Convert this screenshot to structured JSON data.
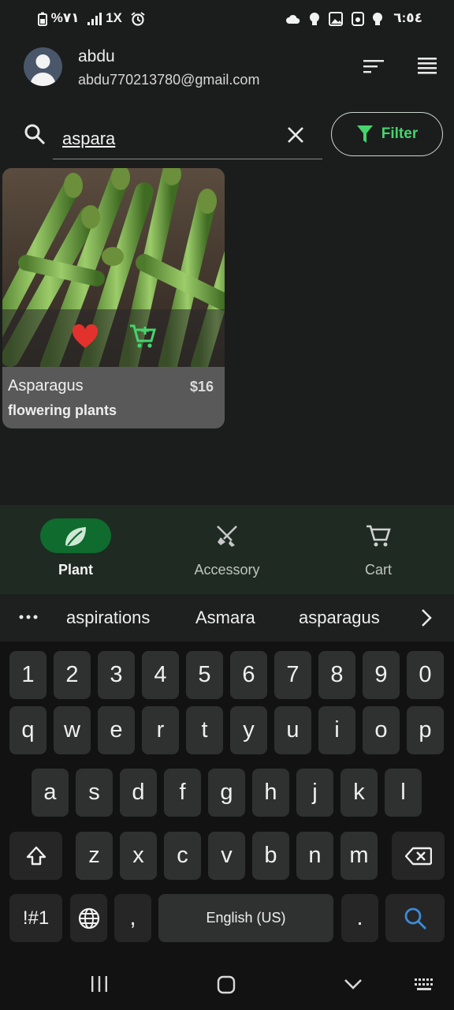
{
  "status_bar": {
    "left_text": "%٧١",
    "signal_text": "1X",
    "time": "٦:٥٤"
  },
  "header": {
    "user_name": "abdu",
    "user_email": "abdu770213780@gmail.com"
  },
  "search": {
    "value": "aspara",
    "filter_label": "Filter"
  },
  "product": {
    "name": "Asparagus",
    "price": "$16",
    "category": "flowering plants"
  },
  "bottom_nav": {
    "items": [
      {
        "label": "Plant",
        "active": true
      },
      {
        "label": "Accessory",
        "active": false
      },
      {
        "label": "Cart",
        "active": false
      }
    ]
  },
  "keyboard": {
    "suggestions": [
      "aspirations",
      "Asmara",
      "asparagus"
    ],
    "row1": [
      "1",
      "2",
      "3",
      "4",
      "5",
      "6",
      "7",
      "8",
      "9",
      "0"
    ],
    "row2": [
      "q",
      "w",
      "e",
      "r",
      "t",
      "y",
      "u",
      "i",
      "o",
      "p"
    ],
    "row3": [
      "a",
      "s",
      "d",
      "f",
      "g",
      "h",
      "j",
      "k",
      "l"
    ],
    "row4": [
      "z",
      "x",
      "c",
      "v",
      "b",
      "n",
      "m"
    ],
    "symbols_label": "!#1",
    "comma_label": ",",
    "space_label": "English (US)",
    "period_label": "."
  },
  "colors": {
    "accent": "#46d46e",
    "heart": "#e3322d",
    "nav_pill": "#0f6b2e",
    "search_key": "#3d8bd9"
  }
}
